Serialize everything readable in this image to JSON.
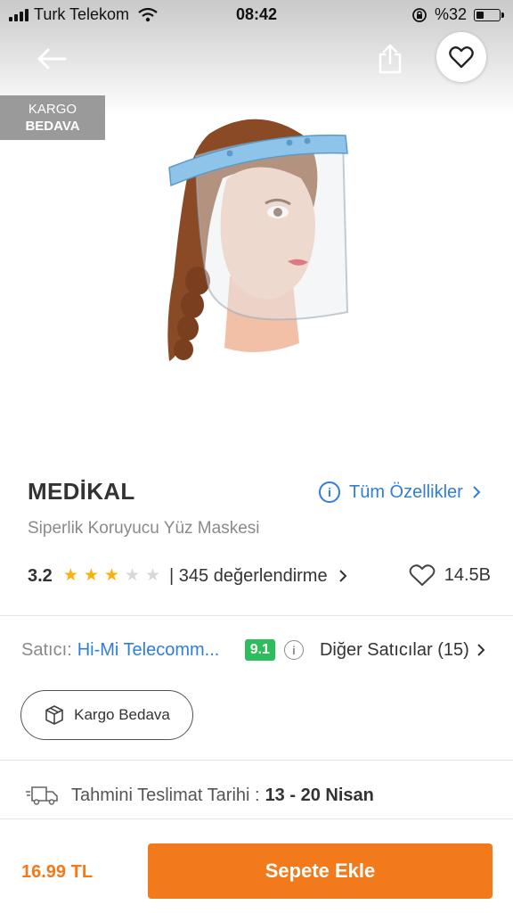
{
  "status_bar": {
    "carrier": "Turk Telekom",
    "time": "08:42",
    "battery_percent": "%32",
    "battery_level": 0.32
  },
  "hero": {
    "badge_line1": "KARGO",
    "badge_line2": "BEDAVA",
    "icons": [
      "back-arrow-icon",
      "share-icon",
      "heart-icon"
    ]
  },
  "product": {
    "brand": "MEDİKAL",
    "all_features_label": "Tüm Özellikler",
    "name": "Siperlik Koruyucu Yüz Maskesi",
    "rating": "3.2",
    "rating_value": 3.2,
    "rating_max": 5,
    "reviews_label": "| 345 değerlendirme",
    "favorite_count": "14.5B"
  },
  "seller": {
    "label": "Satıcı:",
    "name": "Hi-Mi Telecomm...",
    "score": "9.1",
    "other_sellers_label": "Diğer Satıcılar (15)"
  },
  "shipping": {
    "free_cargo_label": "Kargo Bedava",
    "delivery_label": "Tahmini Teslimat Tarihi :",
    "delivery_dates": "13 - 20 Nisan"
  },
  "bottom_bar": {
    "price": "16.99 TL",
    "add_to_cart_label": "Sepete Ekle"
  },
  "colors": {
    "accent_orange": "#f27a1a",
    "link_blue": "#2f7ed8",
    "star_yellow": "#f9b10b",
    "score_green": "#2fbd5c"
  }
}
